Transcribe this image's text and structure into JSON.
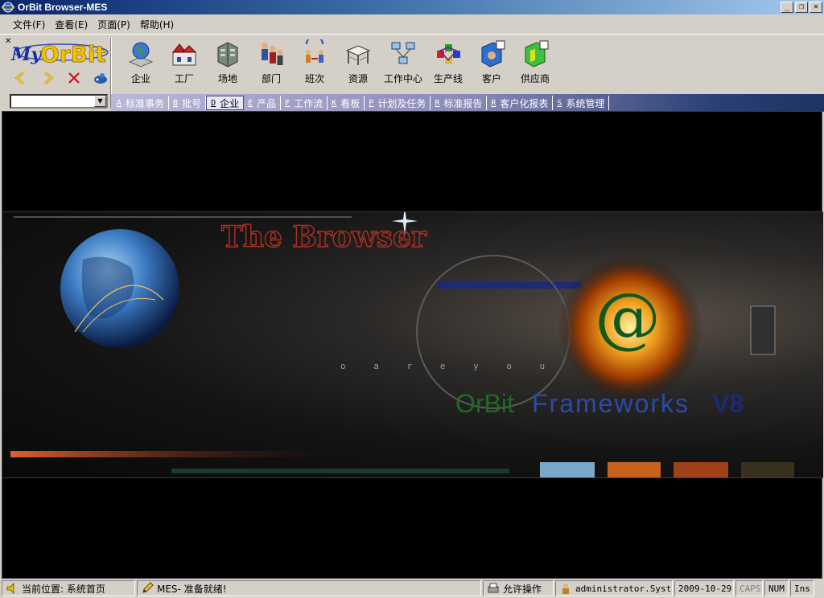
{
  "window": {
    "title": "OrBit Browser-MES",
    "controls": [
      "minimize",
      "restore",
      "close"
    ]
  },
  "menu": [
    "文件(F)",
    "查看(E)",
    "页面(P)",
    "帮助(H)"
  ],
  "logo": {
    "text": "MyOrBit"
  },
  "nav_buttons": [
    {
      "name": "back-icon"
    },
    {
      "name": "forward-icon"
    },
    {
      "name": "stop-icon"
    },
    {
      "name": "home-icon"
    }
  ],
  "combo": {
    "value": ""
  },
  "toolbar": [
    {
      "label": "企业",
      "icon": "enterprise-globe-icon"
    },
    {
      "label": "工厂",
      "icon": "factory-icon"
    },
    {
      "label": "场地",
      "icon": "site-building-icon"
    },
    {
      "label": "部门",
      "icon": "department-people-icon"
    },
    {
      "label": "班次",
      "icon": "shift-icon"
    },
    {
      "label": "资源",
      "icon": "resource-desk-icon"
    },
    {
      "label": "工作中心",
      "icon": "work-center-icon"
    },
    {
      "label": "生产线",
      "icon": "production-line-icon"
    },
    {
      "label": "客户",
      "icon": "customer-icon"
    },
    {
      "label": "供应商",
      "icon": "supplier-icon"
    }
  ],
  "tabs": [
    {
      "key": "A",
      "label": "标准事务"
    },
    {
      "key": "B",
      "label": "批号"
    },
    {
      "key": "D",
      "label": "企业",
      "active": true
    },
    {
      "key": "E",
      "label": "产品"
    },
    {
      "key": "F",
      "label": "工作流"
    },
    {
      "key": "K",
      "label": "看板"
    },
    {
      "key": "P",
      "label": "计划及任务"
    },
    {
      "key": "R",
      "label": "标准报告"
    },
    {
      "key": "R",
      "label": "客户化报表"
    },
    {
      "key": "S",
      "label": "系统管理"
    }
  ],
  "banner": {
    "headline": "The Browser",
    "tagline": "o   a r e   y o u",
    "at_symbol": "@",
    "product_word1": "OrBit",
    "product_word2": "Frameworks",
    "version": "V8"
  },
  "status": {
    "location": "当前位置: 系统首页",
    "message": "MES- 准备就绪!",
    "permission": "允许操作",
    "user": "administrator.System",
    "date": "2009-10-29",
    "caps": "CAPS",
    "num": "NUM",
    "ins": "Ins"
  },
  "colors": {
    "title_bar": "#0a246a",
    "tab_strip": "#2a3f73",
    "headline": "#b03020",
    "orbit_text": "#1f6b1f",
    "frameworks_text": "#2a4aa8"
  }
}
